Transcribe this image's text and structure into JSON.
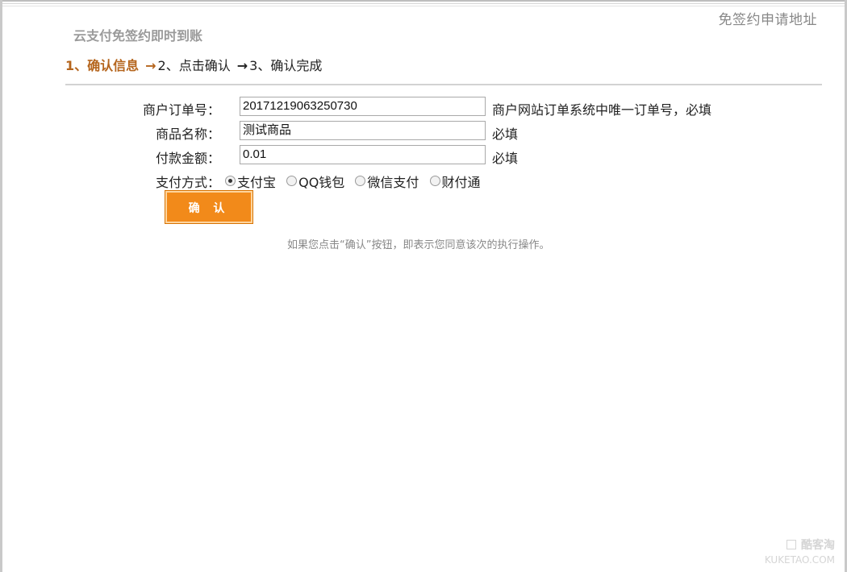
{
  "header": {
    "apply_link": "免签约申请地址",
    "site_title": "云支付免签约即时到账"
  },
  "steps": [
    {
      "label": "1、确认信息",
      "active": true
    },
    {
      "label": "2、点击确认",
      "active": false
    },
    {
      "label": "3、确认完成",
      "active": false
    }
  ],
  "form": {
    "order_no": {
      "label": "商户订单号：",
      "value": "20171219063250730",
      "hint": "商户网站订单系统中唯一订单号，必填"
    },
    "product_name": {
      "label": "商品名称：",
      "value": "测试商品",
      "hint": "必填"
    },
    "amount": {
      "label": "付款金额：",
      "value": "0.01",
      "hint": "必填"
    },
    "payment": {
      "label": "支付方式：",
      "options": [
        "支付宝",
        "QQ钱包",
        "微信支付",
        "财付通"
      ],
      "selected": "支付宝"
    }
  },
  "confirm_button": "确 认",
  "agree_text": "如果您点击“确认”按钮，即表示您同意该次的执行操作。",
  "watermark": {
    "cn": "酷客淘",
    "en": "KUKETAO.COM"
  },
  "colors": {
    "accent": "#f28a1a",
    "step_active": "#b5651d"
  }
}
